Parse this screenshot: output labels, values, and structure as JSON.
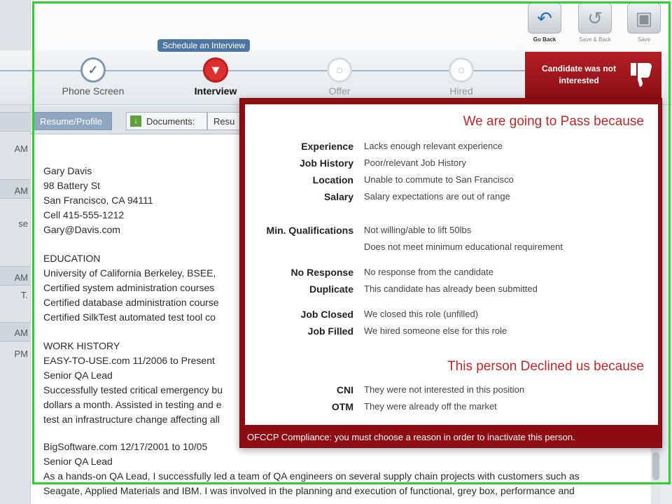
{
  "toolbar": {
    "buttons": [
      {
        "label": "Go Back",
        "icon": "back-arrow-icon"
      },
      {
        "label": "Save & Back",
        "icon": "save-back-icon"
      },
      {
        "label": "Save",
        "icon": "save-icon"
      }
    ]
  },
  "progress": {
    "tooltip": "Schedule an Interview",
    "stages": [
      {
        "name": "Phone Screen",
        "state": "done"
      },
      {
        "name": "Interview",
        "state": "active"
      },
      {
        "name": "Offer",
        "state": "future"
      },
      {
        "name": "Hired",
        "state": "future"
      }
    ]
  },
  "not_interested_button": {
    "label": "Candidate was not interested",
    "icon": "thumbs-down-icon"
  },
  "tabs": [
    {
      "label": "Resume/Profile",
      "active": true
    },
    {
      "label": "Documents:",
      "active": false
    },
    {
      "label": "Resu",
      "active": false
    }
  ],
  "left_strip": {
    "texts": [
      "AM",
      "AM",
      "se",
      "AM",
      "T.",
      "AM",
      "PM"
    ]
  },
  "resume": {
    "lines": [
      "Gary Davis",
      "98 Battery St",
      "San Francisco, CA 94111",
      "Cell 415-555-1212",
      "Gary@Davis.com",
      "",
      "EDUCATION",
      "University of California Berkeley, BSEE,",
      "Certified system administration courses",
      "Certified database administration course",
      "Certified SilkTest automated test tool co",
      "",
      "WORK HISTORY",
      "EASY-TO-USE.com 11/2006 to Present",
      "Senior QA Lead",
      "Successfully tested critical emergency bu",
      "dollars a month. Assisted in testing and e",
      "test an infrastructure change affecting all",
      "",
      "BigSoftware.com 12/17/2001 to 10/05",
      "Senior QA Lead",
      "As a hands-on QA Lead, I successfully led a team of QA engineers on several supply chain projects with customers such as",
      "Seagate, Applied Materials and IBM. I was involved in the planning and execution of functional, grey box, performance and"
    ]
  },
  "popup": {
    "pass_title": "We are going to Pass because",
    "pass_reasons": [
      {
        "category": "Experience",
        "description": "Lacks enough relevant experience"
      },
      {
        "category": "Job History",
        "description": "Poor/relevant Job History"
      },
      {
        "category": "Location",
        "description": "Unable to commute to San Francisco"
      },
      {
        "category": "Salary",
        "description": "Salary expectations are out of range"
      },
      {
        "category": "Min. Qualifications",
        "description": "Not willing/able to lift 50lbs"
      },
      {
        "category": "",
        "description": "Does not meet minimum educational requirement"
      },
      {
        "category": "No Response",
        "description": "No response from the candidate"
      },
      {
        "category": "Duplicate",
        "description": "This candidate has already been submitted"
      },
      {
        "category": "Job Closed",
        "description": "We closed this role (unfilled)"
      },
      {
        "category": "Job Filled",
        "description": "We hired someone else for this role"
      }
    ],
    "declined_title": "This person Declined us because",
    "declined_reasons": [
      {
        "category": "CNI",
        "description": "They were not interested in this position"
      },
      {
        "category": "OTM",
        "description": "They were already off the market"
      }
    ],
    "compliance_note": "OFCCP Compliance: you must choose a reason in order to inactivate this person."
  },
  "colors": {
    "accent_red": "#c2262b",
    "popup_border": "#8e0c12",
    "highlight_frame": "#2fd12f",
    "tooltip_blue": "#4d76a4"
  }
}
